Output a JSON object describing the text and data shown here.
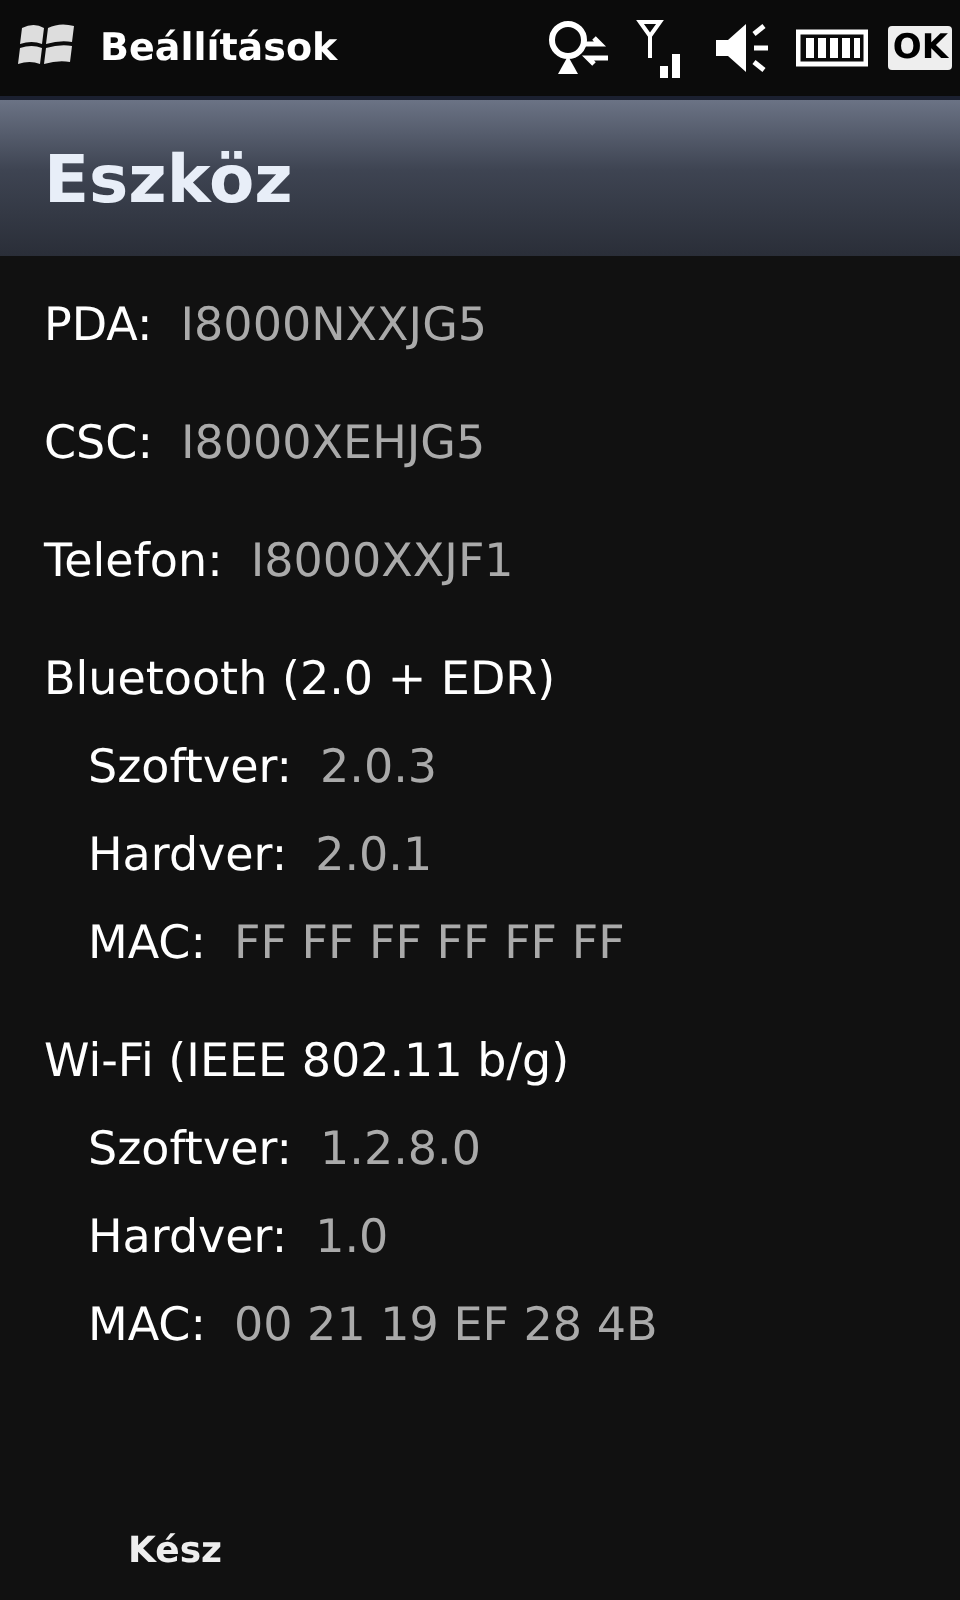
{
  "status_bar": {
    "title": "Beállítások",
    "ok": "OK"
  },
  "header": {
    "title": "Eszköz"
  },
  "rows": [
    {
      "label": "PDA:",
      "value": "I8000NXXJG5"
    },
    {
      "label": "CSC:",
      "value": "I8000XEHJG5"
    },
    {
      "label": "Telefon:",
      "value": "I8000XXJF1"
    }
  ],
  "sections": [
    {
      "title": "Bluetooth (2.0 + EDR)",
      "rows": [
        {
          "label": "Szoftver:",
          "value": "2.0.3"
        },
        {
          "label": "Hardver:",
          "value": "2.0.1"
        },
        {
          "label": "MAC:",
          "value": "FF FF FF FF FF FF"
        }
      ]
    },
    {
      "title": "Wi-Fi (IEEE 802.11 b/g)",
      "rows": [
        {
          "label": "Szoftver:",
          "value": "1.2.8.0"
        },
        {
          "label": "Hardver:",
          "value": "1.0"
        },
        {
          "label": "MAC:",
          "value": "00 21 19 EF 28 4B"
        }
      ]
    }
  ],
  "menu_bar": {
    "left": "Kész"
  }
}
